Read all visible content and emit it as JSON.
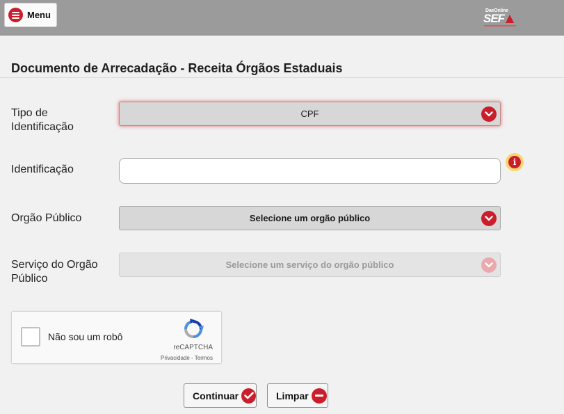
{
  "header": {
    "menu_label": "Menu",
    "logo_top": "DaeOnline",
    "logo_main": "SEF"
  },
  "page_title": "Documento de Arrecadação - Receita Órgãos Estaduais",
  "form": {
    "tipo": {
      "label_line1": "Tipo de",
      "label_line2": "Identificação",
      "value": "CPF"
    },
    "identificacao": {
      "label": "Identificação",
      "value": ""
    },
    "orgao": {
      "label": "Orgão Público",
      "value": "Selecione um orgão público"
    },
    "servico": {
      "label_line1": "Serviço do Orgão",
      "label_line2": "Público",
      "value": "Selecione um serviço do orgão público"
    }
  },
  "captcha": {
    "label": "Não sou um robô",
    "brand": "reCAPTCHA",
    "links": "Privacidade - Termos"
  },
  "buttons": {
    "continuar": "Continuar",
    "limpar": "Limpar"
  },
  "colors": {
    "accent": "#cc1d2b",
    "header_bg": "#9b9b9b",
    "page_bg": "#f1f1f1"
  }
}
